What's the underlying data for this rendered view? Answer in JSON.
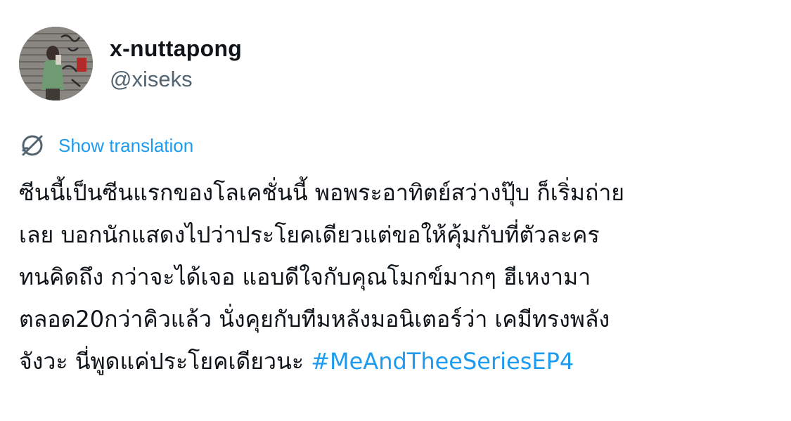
{
  "user": {
    "display_name": "x-nuttapong",
    "handle": "@xiseks",
    "avatar_icon": "profile-photo"
  },
  "translation": {
    "label": "Show translation",
    "icon": "translate-globe-icon"
  },
  "tweet": {
    "lines": [
      "ซีนนี้เป็นซีนแรกของโลเคชั่นนี้ พอพระอาทิตย์สว่างปุ๊บ ก็เริ่มถ่าย",
      "เลย บอกนักแสดงไปว่าประโยคเดียวแต่ขอให้คุ้มกับที่ตัวละคร",
      "ทนคิดถึง กว่าจะได้เจอ แอบดีใจกับคุณโมกข์มากๆ ฮีเหงามา",
      "ตลอด20กว่าคิวแล้ว นั่งคุยกับทีมหลังมอนิเตอร์ว่า เคมีทรงพลัง"
    ],
    "last_line_text": "จังวะ นี่พูดแค่ประโยคเดียวนะ ",
    "hashtag": "#MeAndTheeSeriesEP4"
  },
  "colors": {
    "link": "#1d9bf0",
    "text": "#0f1419",
    "secondary": "#536471"
  }
}
